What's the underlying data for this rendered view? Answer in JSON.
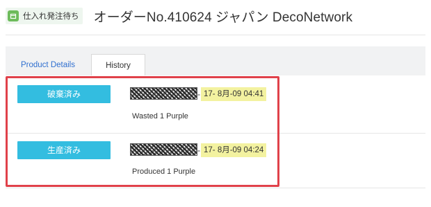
{
  "header": {
    "status_badge": "仕入れ発注待ち",
    "title": "オーダーNo.410624 ジャパン DecoNetwork"
  },
  "tabs": {
    "product_details": "Product Details",
    "history": "History"
  },
  "history": [
    {
      "action": "破棄済み",
      "separator": "-",
      "timestamp": "17- 8月-09 04:41",
      "description": "Wasted 1 Purple"
    },
    {
      "action": "生産済み",
      "separator": "-",
      "timestamp": "17- 8月-09 04:24",
      "description": "Produced 1 Purple"
    }
  ],
  "colors": {
    "badge_icon": "#6dbb5b",
    "action_badge": "#33bde0",
    "timestamp_highlight": "#f3f2a0",
    "annotation_box": "#e0414a",
    "link": "#2f6fcf"
  }
}
